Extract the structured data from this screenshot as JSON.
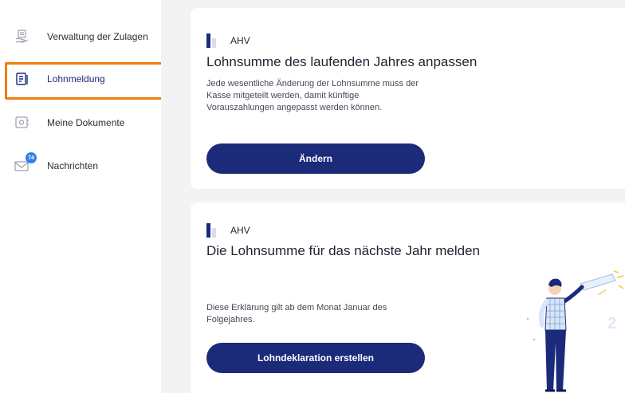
{
  "sidebar": {
    "items": [
      {
        "label": "Verwaltung der Zulagen",
        "icon": "hand-coin-icon"
      },
      {
        "label": "Lohnmeldung",
        "icon": "document-list-icon"
      },
      {
        "label": "Meine Dokumente",
        "icon": "documents-safe-icon"
      },
      {
        "label": "Nachrichten",
        "icon": "envelope-icon",
        "badge": "74"
      }
    ],
    "active_index": 1
  },
  "cards": [
    {
      "tag": "AHV",
      "title": "Lohnsumme des laufenden Jahres anpassen",
      "description": "Jede wesentliche Änderung der Lohnsumme muss der Kasse mitgeteilt werden, damit künftige Vorauszahlungen angepasst werden können.",
      "button": "Ändern"
    },
    {
      "tag": "AHV",
      "title": "Die Lohnsumme für das nächste Jahr melden",
      "description": "Diese Erklärung gilt ab dem Monat Januar des Folgejahres.",
      "button": "Lohndeklaration erstellen"
    }
  ],
  "colors": {
    "primary": "#1c2a7a",
    "highlight": "#f07d0d",
    "badge": "#2f80ed",
    "background": "#f3f3f3"
  }
}
